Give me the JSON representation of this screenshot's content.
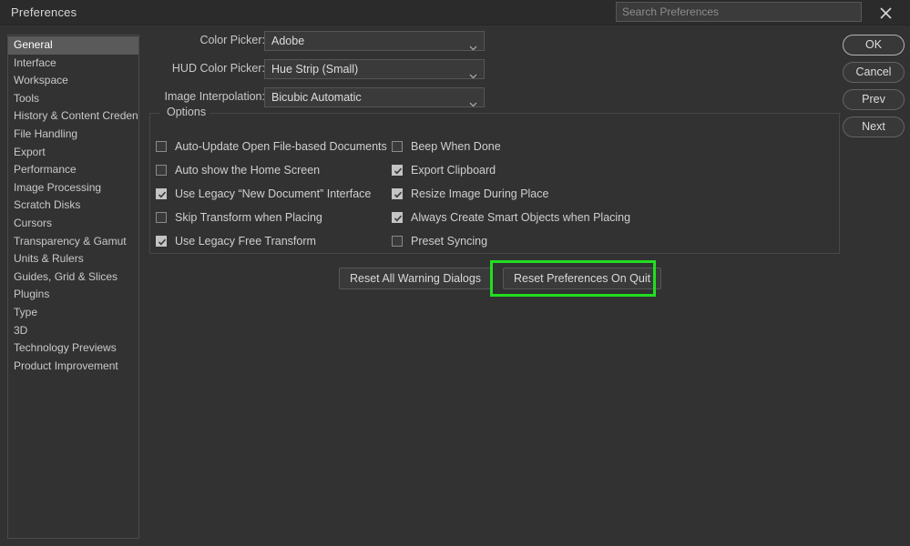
{
  "window": {
    "title": "Preferences",
    "close_icon": "close-icon"
  },
  "search": {
    "placeholder": "Search Preferences",
    "value": ""
  },
  "sidebar": {
    "selected": "General",
    "items": [
      {
        "label": "General"
      },
      {
        "label": "Interface"
      },
      {
        "label": "Workspace"
      },
      {
        "label": "Tools"
      },
      {
        "label": "History & Content Credentials"
      },
      {
        "label": "File Handling"
      },
      {
        "label": "Export"
      },
      {
        "label": "Performance"
      },
      {
        "label": "Image Processing"
      },
      {
        "label": "Scratch Disks"
      },
      {
        "label": "Cursors"
      },
      {
        "label": "Transparency & Gamut"
      },
      {
        "label": "Units & Rulers"
      },
      {
        "label": "Guides, Grid & Slices"
      },
      {
        "label": "Plugins"
      },
      {
        "label": "Type"
      },
      {
        "label": "3D"
      },
      {
        "label": "Technology Previews"
      },
      {
        "label": "Product Improvement"
      }
    ]
  },
  "fields": [
    {
      "label": "Color Picker:",
      "value": "Adobe"
    },
    {
      "label": "HUD Color Picker:",
      "value": "Hue Strip (Small)"
    },
    {
      "label": "Image Interpolation:",
      "value": "Bicubic Automatic"
    }
  ],
  "options": {
    "legend": "Options",
    "left": [
      {
        "label": "Auto-Update Open File-based Documents",
        "checked": false
      },
      {
        "label": "Auto show the Home Screen",
        "checked": false
      },
      {
        "label": "Use Legacy “New Document” Interface",
        "checked": true
      },
      {
        "label": "Skip Transform when Placing",
        "checked": false
      },
      {
        "label": "Use Legacy Free Transform",
        "checked": true
      }
    ],
    "right": [
      {
        "label": "Beep When Done",
        "checked": false
      },
      {
        "label": "Export Clipboard",
        "checked": true
      },
      {
        "label": "Resize Image During Place",
        "checked": true
      },
      {
        "label": "Always Create Smart Objects when Placing",
        "checked": true
      },
      {
        "label": "Preset Syncing",
        "checked": false
      }
    ]
  },
  "reset_buttons": {
    "warnings": "Reset All Warning Dialogs",
    "prefs_on_quit": "Reset Preferences On Quit"
  },
  "actions": [
    {
      "label": "OK"
    },
    {
      "label": "Cancel"
    },
    {
      "label": "Prev"
    },
    {
      "label": "Next"
    }
  ],
  "colors": {
    "window_bg": "#323232",
    "titlebar_bg": "#2b2b2b",
    "panel_border": "#4a4a4a",
    "selection_bg": "#5a5a5a",
    "highlight_accent": "#22dd22",
    "text": "#c8c8c8"
  }
}
